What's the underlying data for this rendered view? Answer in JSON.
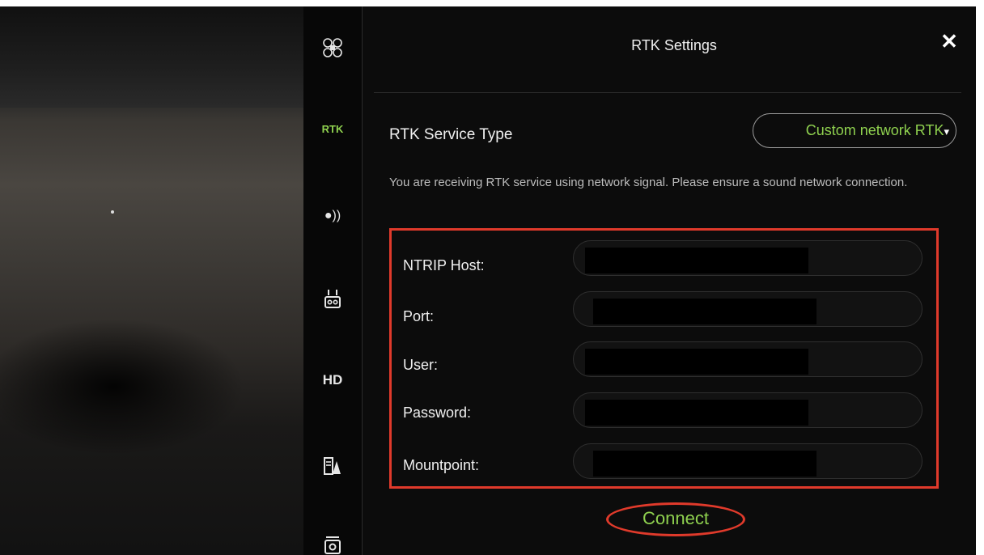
{
  "rail": {
    "items": [
      {
        "icon": "drone-icon"
      },
      {
        "label": "RTK",
        "color": "#8fd14f"
      },
      {
        "icon": "signal-icon",
        "label": "●))"
      },
      {
        "icon": "remote-controller-icon"
      },
      {
        "label": "HD"
      },
      {
        "icon": "flight-assist-icon"
      },
      {
        "icon": "camera-icon"
      }
    ]
  },
  "panel": {
    "title": "RTK Settings",
    "close_label": "✕",
    "service_type_label": "RTK Service Type",
    "service_type_value": "Custom network RTK",
    "service_type_caret": "▾",
    "notice": "You are receiving RTK service using network signal. Please ensure a sound network connection.",
    "fields": [
      {
        "label": "NTRIP Host:",
        "value_redacted": true
      },
      {
        "label": "Port:",
        "value_redacted": true
      },
      {
        "label": "User:",
        "value_redacted": true
      },
      {
        "label": "Password:",
        "value_redacted": true
      },
      {
        "label": "Mountpoint:",
        "value_redacted": true
      }
    ],
    "connect_label": "Connect"
  },
  "colors": {
    "accent": "#8fd14f",
    "highlight": "#e03a2b",
    "background": "#0c0c0c"
  }
}
